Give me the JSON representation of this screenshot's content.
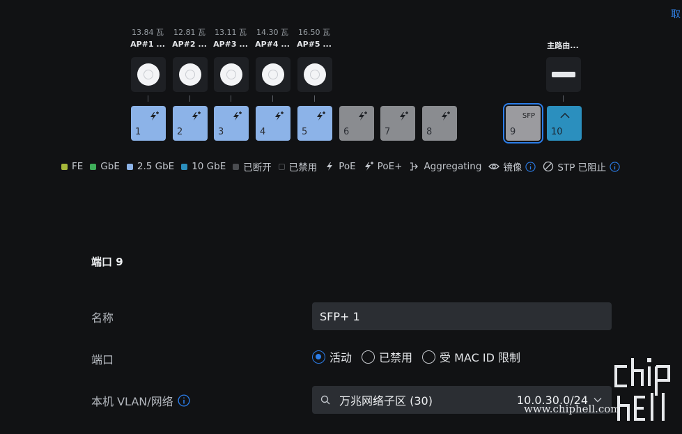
{
  "header": {
    "cancel_label": "取"
  },
  "devices": [
    {
      "watts": "13.84 瓦",
      "name": "AP#1 ...",
      "icon": "access-point-icon"
    },
    {
      "watts": "12.81 瓦",
      "name": "AP#2 ...",
      "icon": "access-point-icon"
    },
    {
      "watts": "13.11 瓦",
      "name": "AP#3 ...",
      "icon": "access-point-icon"
    },
    {
      "watts": "14.30 瓦",
      "name": "AP#4 ...",
      "icon": "access-point-icon"
    },
    {
      "watts": "16.50 瓦",
      "name": "AP#5 ...",
      "icon": "access-point-icon"
    }
  ],
  "router": {
    "name": "主路由...",
    "icon": "router-icon"
  },
  "ports": [
    {
      "num": "1",
      "state": "2.5 GbE",
      "poe": "PoE+"
    },
    {
      "num": "2",
      "state": "2.5 GbE",
      "poe": "PoE+"
    },
    {
      "num": "3",
      "state": "2.5 GbE",
      "poe": "PoE+"
    },
    {
      "num": "4",
      "state": "2.5 GbE",
      "poe": "PoE+"
    },
    {
      "num": "5",
      "state": "2.5 GbE",
      "poe": "PoE+"
    },
    {
      "num": "6",
      "state": "已断开",
      "poe": "PoE+"
    },
    {
      "num": "7",
      "state": "已断开",
      "poe": "PoE+"
    },
    {
      "num": "8",
      "state": "已断开",
      "poe": "PoE+"
    },
    {
      "num": "9",
      "label": "SFP",
      "state": "已断开",
      "selected": true
    },
    {
      "num": "10",
      "state": "10 GbE",
      "uplink": true
    }
  ],
  "legend": {
    "speeds": [
      {
        "label": "FE",
        "color": "#a6b83a"
      },
      {
        "label": "GbE",
        "color": "#3fae5a"
      },
      {
        "label": "2.5 GbE",
        "color": "#8cb3e8"
      },
      {
        "label": "10 GbE",
        "color": "#2b8fbe"
      },
      {
        "label": "已断开",
        "color": "#4a4c50"
      },
      {
        "label": "已禁用",
        "color": "transparent"
      }
    ],
    "poe": "PoE",
    "poe_plus": "PoE+",
    "aggregating": "Aggregating",
    "mirror": "镜像",
    "stp_blocked": "STP 已阻止"
  },
  "port_settings": {
    "title": "端口 9",
    "name_label": "名称",
    "name_value": "SFP+ 1",
    "port_label": "端口",
    "port_options": [
      "活动",
      "已禁用",
      "受 MAC ID 限制"
    ],
    "port_selected": "活动",
    "vlan_label": "本机 VLAN/网络",
    "vlan_network": "万兆网络子区 (30)",
    "vlan_subnet": "10.0.30.0/24"
  },
  "watermark": {
    "url": "www.chiphell.com"
  },
  "colors": {
    "accent": "#2b7de9",
    "port_2_5g": "#8cb3e8",
    "port_disconnected": "#8a8c90",
    "port_10g": "#2b8fbe",
    "background": "#111214"
  }
}
